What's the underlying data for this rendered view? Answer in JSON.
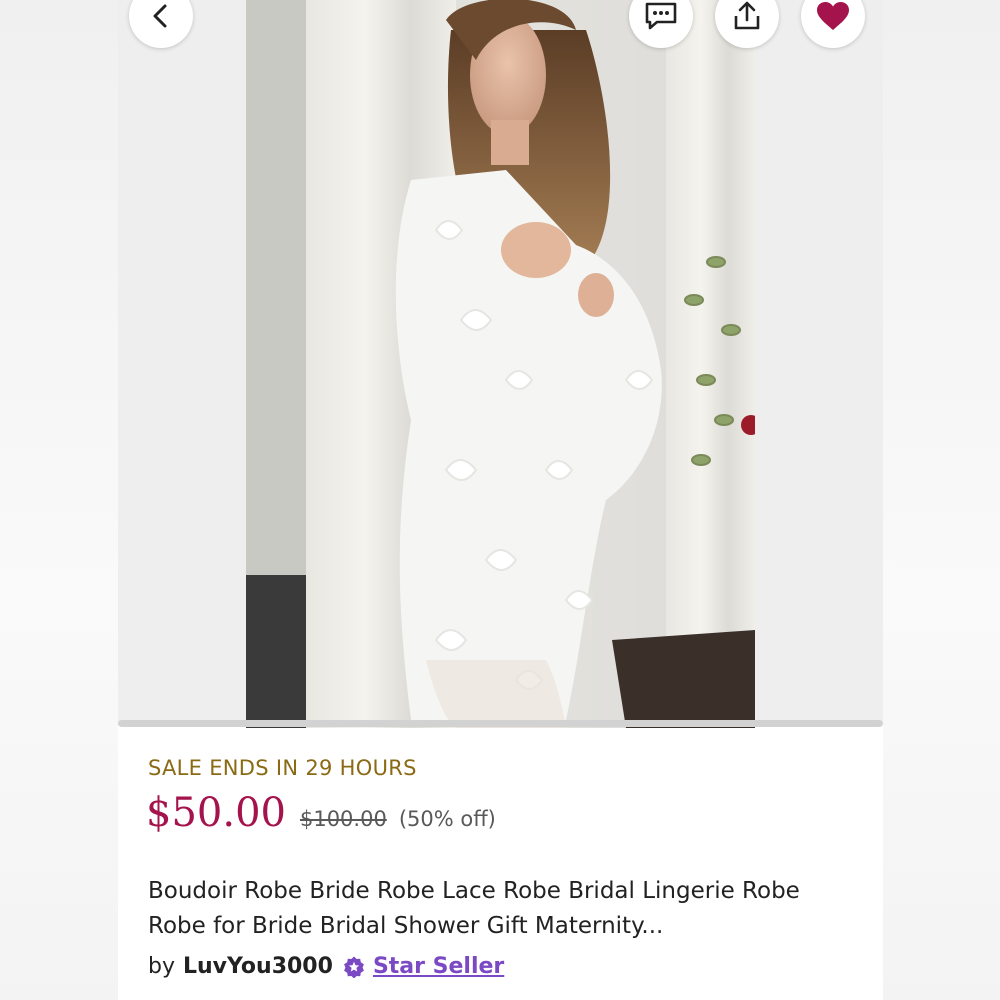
{
  "navigation": {
    "back_icon": "chevron-left-icon",
    "message_icon": "message-bubble-icon",
    "share_icon": "share-upload-icon",
    "favorite_icon": "heart-filled-icon"
  },
  "listing": {
    "sale_banner": "SALE ENDS IN 29 HOURS",
    "price": "$50.00",
    "original_price": "$100.00",
    "discount": "(50% off)",
    "title_line1": "Boudoir Robe Bride Robe Lace Robe Bridal Lingerie Robe",
    "title_line2": "Robe for Bride Bridal Shower Gift Maternity...",
    "seller_prefix": "by",
    "seller_name": "LuvYou3000",
    "seller_badge": "Star Seller"
  },
  "colors": {
    "price": "#a4134c",
    "sale_banner": "#8a6a14",
    "favorite": "#a4134c",
    "star_seller": "#7b49c4"
  }
}
